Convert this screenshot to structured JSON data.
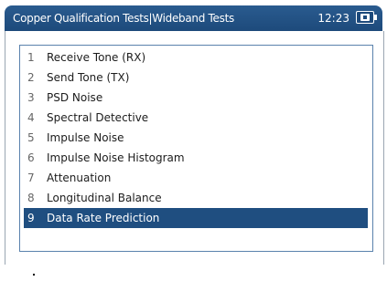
{
  "window": {
    "title": "Copper Qualification Tests|Wideband Tests",
    "clock": "12:23"
  },
  "menu": {
    "items": [
      {
        "num": "1",
        "label": "Receive Tone (RX)"
      },
      {
        "num": "2",
        "label": "Send Tone (TX)"
      },
      {
        "num": "3",
        "label": "PSD Noise"
      },
      {
        "num": "4",
        "label": "Spectral Detective"
      },
      {
        "num": "5",
        "label": "Impulse Noise"
      },
      {
        "num": "6",
        "label": "Impulse Noise Histogram"
      },
      {
        "num": "7",
        "label": "Attenuation"
      },
      {
        "num": "8",
        "label": "Longitudinal Balance"
      },
      {
        "num": "9",
        "label": "Data Rate Prediction"
      }
    ],
    "selected_index": 8
  },
  "icons": {
    "battery": "battery-plug-icon"
  },
  "colors": {
    "titlebar": "#1d4a7b",
    "selection": "#1f4e80",
    "list_border": "#5a82ad"
  }
}
